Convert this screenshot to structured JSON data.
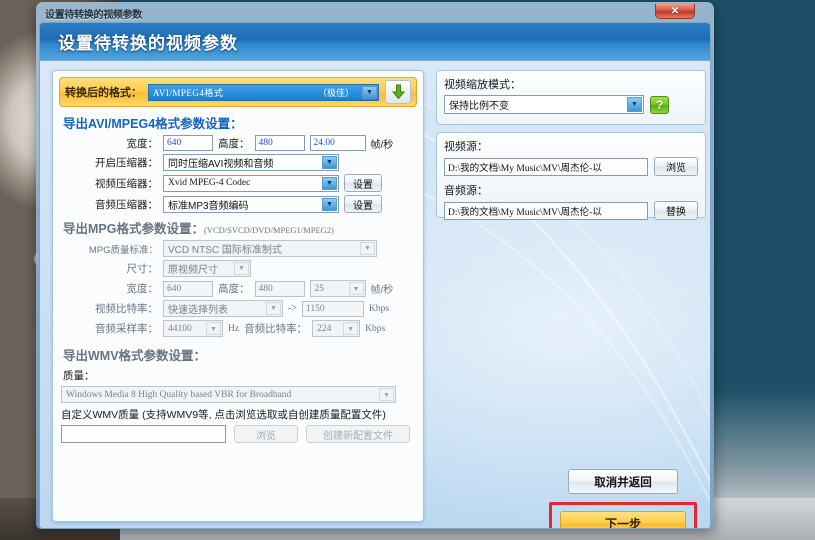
{
  "window": {
    "titlebar_text": "设置待转换的视频参数",
    "close_label": "✕",
    "header_title": "设置待转换的视频参数"
  },
  "format_bar": {
    "label": "转换后的格式：",
    "value": "AVI/MPEG4格式",
    "quality": "（极佳）",
    "dropdown_arrow": "▼",
    "download_icon": "download-arrow-icon"
  },
  "avi": {
    "section_title": "导出AVI/MPEG4格式参数设置：",
    "width_label": "宽度：",
    "width_value": "640",
    "height_label": "高度：",
    "height_value": "480",
    "fps_value": "24.00",
    "fps_unit": "帧/秒",
    "compressor_label": "开启压缩器：",
    "compressor_value": "同时压缩AVI视频和音频",
    "video_codec_label": "视频压缩器：",
    "video_codec_value": "Xvid MPEG-4 Codec",
    "video_codec_btn": "设置",
    "audio_codec_label": "音频压缩器：",
    "audio_codec_value": "标准MP3音频编码",
    "audio_codec_btn": "设置",
    "arrow": "▼"
  },
  "mpg": {
    "section_title": "导出MPG格式参数设置：",
    "section_note": "(VCD/SVCD/DVD/MPEG1/MPEG2)",
    "quality_label": "MPG质量标准：",
    "quality_value": "VCD  NTSC 国际标准制式",
    "size_label": "尺寸：",
    "size_value": "原视频尺寸",
    "width_label": "宽度：",
    "width_value": "640",
    "height_label": "高度：",
    "height_value": "480",
    "fps_value": "25",
    "fps_unit": "帧/秒",
    "vbitrate_label": "视频比特率：",
    "vbitrate_value": "快速选择列表",
    "vbitrate_arrow": "->",
    "vbitrate_number": "1150",
    "vbitrate_unit": "Kbps",
    "srate_label": "音频采样率：",
    "srate_value": "44100",
    "srate_unit": "Hz",
    "abitrate_label": "音频比特率：",
    "abitrate_value": "224",
    "abitrate_unit": "Kbps",
    "arrow": "▼"
  },
  "wmv": {
    "section_title": "导出WMV格式参数设置：",
    "quality_label": "质量：",
    "quality_value": "Windows Media 8 High Quality based VBR for Broadband",
    "custom_note": "自定义WMV质量 (支持WMV9等, 点击浏览选取或自创建质量配置文件)",
    "custom_value": "",
    "browse_btn": "浏览",
    "create_btn": "创建新配置文件",
    "arrow": "▼"
  },
  "right": {
    "scale_mode_label": "视频缩放模式：",
    "scale_mode_value": "保持比例不变",
    "scale_mode_arrow": "▼",
    "help_label": "?",
    "video_source_label": "视频源：",
    "video_source_path": "D:\\我的文档\\My Music\\MV\\周杰伦-以",
    "video_browse_btn": "浏览",
    "audio_source_label": "音频源：",
    "audio_source_path": "D:\\我的文档\\My Music\\MV\\周杰伦-以",
    "audio_replace_btn": "替换"
  },
  "actions": {
    "cancel_label": "取消并返回",
    "next_label": "下一步",
    "highlight_color": "#e8272a"
  }
}
